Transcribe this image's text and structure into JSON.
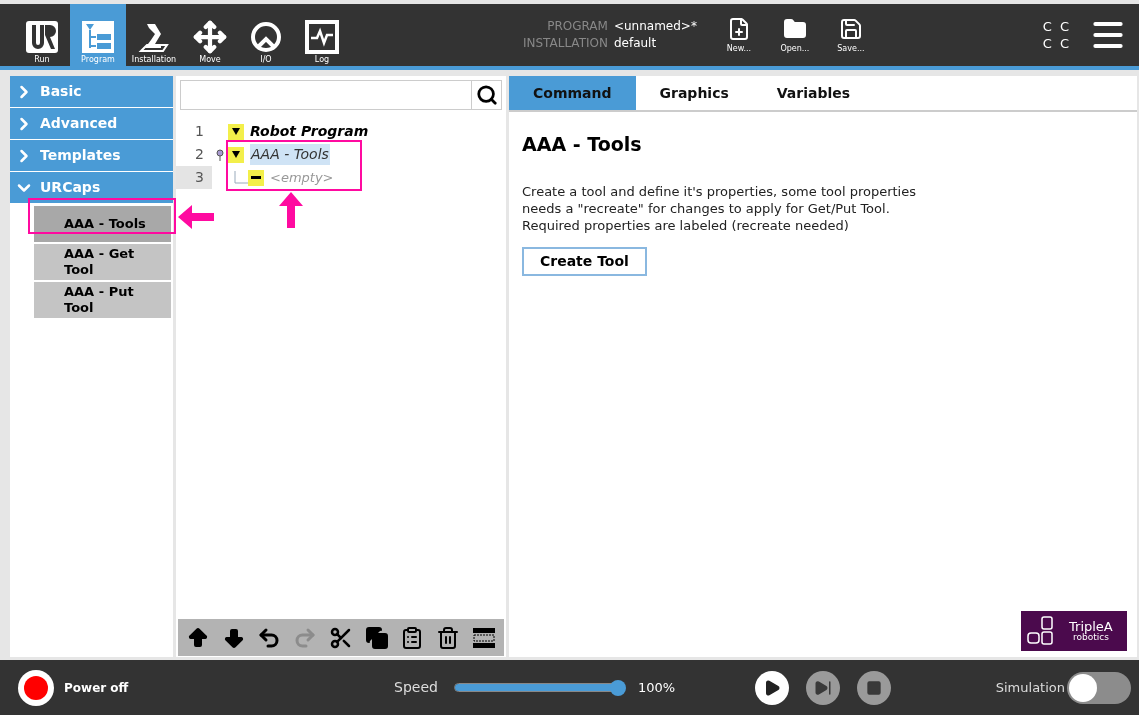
{
  "top_nav": [
    {
      "label": "Run",
      "kind": "logo",
      "selected": false
    },
    {
      "label": "Program",
      "kind": "program",
      "selected": true
    },
    {
      "label": "Installation",
      "kind": "arm",
      "selected": false
    },
    {
      "label": "Move",
      "kind": "move",
      "selected": false
    },
    {
      "label": "I/O",
      "kind": "io",
      "selected": false
    },
    {
      "label": "Log",
      "kind": "log",
      "selected": false
    }
  ],
  "program_info": {
    "program_label": "PROGRAM",
    "program_value": "<unnamed>*",
    "installation_label": "INSTALLATION",
    "installation_value": "default"
  },
  "file_buttons": [
    {
      "label": "New...",
      "kind": "new"
    },
    {
      "label": "Open...",
      "kind": "open"
    },
    {
      "label": "Save...",
      "kind": "save"
    }
  ],
  "status_letters": [
    [
      "C",
      "C"
    ],
    [
      "C",
      "C"
    ]
  ],
  "sidebar": {
    "categories": [
      {
        "label": "Basic",
        "expanded": false
      },
      {
        "label": "Advanced",
        "expanded": false
      },
      {
        "label": "Templates",
        "expanded": false
      },
      {
        "label": "URCaps",
        "expanded": true,
        "children": [
          {
            "label": "AAA - Tools",
            "selected": true
          },
          {
            "label": "AAA - Get Tool",
            "selected": false
          },
          {
            "label": "AAA - Put Tool",
            "selected": false
          }
        ]
      }
    ]
  },
  "tree": {
    "lines": [
      {
        "number": "1",
        "label": "Robot Program",
        "kind": "root",
        "selected": false,
        "cursor": false
      },
      {
        "number": "2",
        "label": "AAA - Tools",
        "kind": "node",
        "selected": true,
        "cursor": false
      },
      {
        "number": "3",
        "label": "<empty>",
        "kind": "empty",
        "selected": false,
        "cursor": true
      }
    ]
  },
  "tree_toolbar": [
    {
      "kind": "up",
      "disabled": false
    },
    {
      "kind": "down",
      "disabled": false
    },
    {
      "kind": "undo",
      "disabled": false
    },
    {
      "kind": "redo",
      "disabled": true
    },
    {
      "kind": "cut",
      "disabled": false
    },
    {
      "kind": "copy",
      "disabled": false
    },
    {
      "kind": "paste",
      "disabled": false
    },
    {
      "kind": "delete",
      "disabled": false
    },
    {
      "kind": "suppress",
      "disabled": false
    }
  ],
  "tabs": [
    {
      "label": "Command",
      "selected": true
    },
    {
      "label": "Graphics",
      "selected": false
    },
    {
      "label": "Variables",
      "selected": false
    }
  ],
  "content": {
    "title": "AAA - Tools",
    "description": "Create a tool and define it's properties, some tool properties needs a \"recreate\" for changes to apply for Get/Put Tool. Required properties are labeled (recreate needed)",
    "button": "Create Tool"
  },
  "logo": {
    "name": "TripleA",
    "tagline": "robotics"
  },
  "footer": {
    "power": "Power off",
    "speed_label": "Speed",
    "speed": {
      "level": 1
    },
    "speed_reading": "100%",
    "playback": [
      {
        "kind": "play",
        "disabled": false
      },
      {
        "kind": "step",
        "disabled": true
      },
      {
        "kind": "stop",
        "disabled": true
      }
    ],
    "simulation_label": "Simulation",
    "simulation_on": false
  }
}
